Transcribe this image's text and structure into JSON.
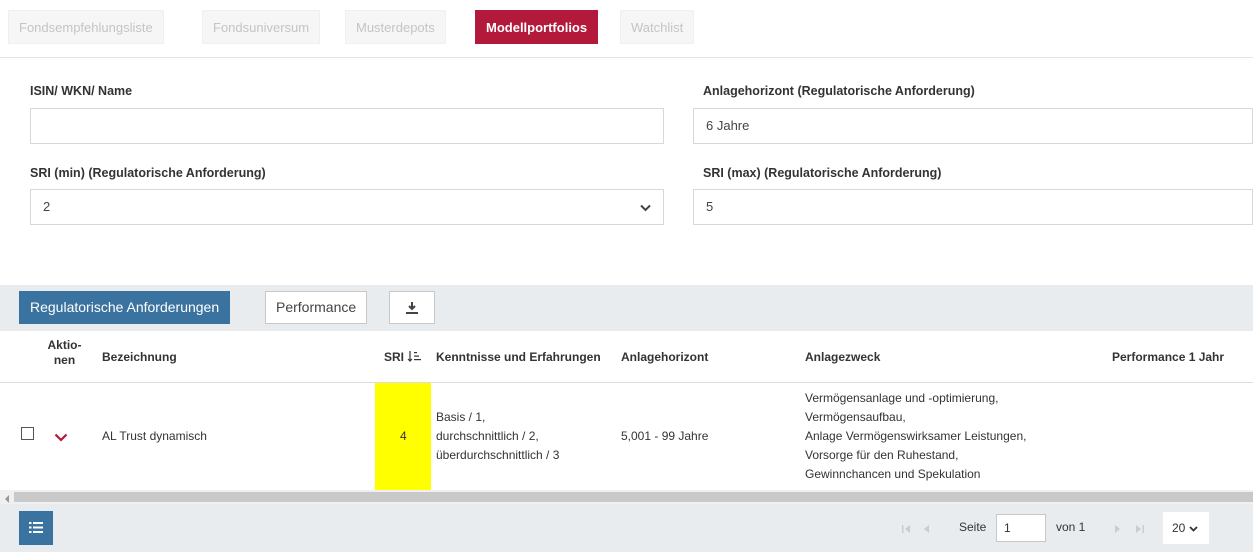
{
  "tabs": [
    "Fondsempfehlungsliste",
    "Fondsuniversum",
    "Musterdepots",
    "Modellportfolios",
    "Watchlist"
  ],
  "form": {
    "isin_label": "ISIN/ WKN/ Name",
    "isin_value": "",
    "horizon_label": "Anlagehorizont (Regulatorische Anforderung)",
    "horizon_value": "6 Jahre",
    "sri_min_label": "SRI (min) (Regulatorische Anforderung)",
    "sri_min_value": "2",
    "sri_max_label": "SRI (max) (Regulatorische Anforderung)",
    "sri_max_value": "5"
  },
  "toolbar": {
    "regulatory_label": "Regulatorische Anforderungen",
    "performance_label": "Performance"
  },
  "columns": {
    "actions_line1": "Aktio-",
    "actions_line2": "nen",
    "name": "Bezeichnung",
    "sri": "SRI",
    "knowledge": "Kenntnisse und Erfahrungen",
    "horizon": "Anlagehorizont",
    "purpose": "Anlagezweck",
    "perf": "Performance 1 Jahr"
  },
  "row": {
    "name": "AL Trust dynamisch",
    "sri": "4",
    "knowledge": [
      "Basis / 1,",
      "durchschnittlich / 2,",
      "überdurchschnittlich / 3"
    ],
    "horizon": "5,001 - 99 Jahre",
    "purpose": [
      "Vermögensanlage und -optimierung,",
      "Vermögensaufbau,",
      "Anlage Vermögenswirksamer Leistungen,",
      "Vorsorge für den Ruhestand,",
      "Gewinnchancen und Spekulation"
    ]
  },
  "pager": {
    "page_label": "Seite",
    "page_value": "1",
    "of_label": "von 1",
    "page_size": "20"
  },
  "colors": {
    "accent": "#b2193a",
    "primary": "#3a72a0",
    "highlight": "#ffff00"
  }
}
